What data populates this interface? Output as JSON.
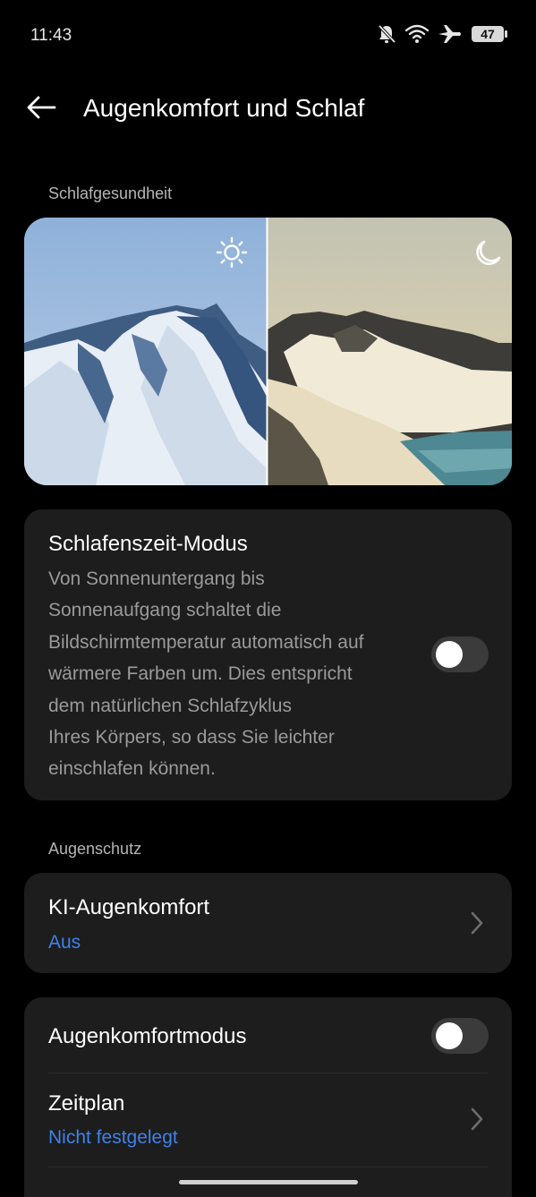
{
  "status_bar": {
    "time": "11:43",
    "battery": "47",
    "icons": [
      "bell-off-icon",
      "wifi-icon",
      "airplane-icon",
      "battery-icon"
    ]
  },
  "header": {
    "title": "Augenkomfort und Schlaf",
    "back_icon": "arrow-left-icon"
  },
  "sections": {
    "sleep_health": "Schlafgesundheit",
    "eye_protection": "Augenschutz"
  },
  "preview": {
    "day_icon": "sun-icon",
    "night_icon": "moon-icon"
  },
  "bedtime_mode": {
    "title": "Schlafenszeit-Modus",
    "description_lines": [
      "Von Sonnenuntergang bis",
      "Sonnenaufgang schaltet die",
      "Bildschirmtemperatur automatisch auf",
      "wärmere Farben um. Dies entspricht",
      "dem natürlichen Schlafzyklus",
      "Ihres Körpers, so dass Sie leichter",
      "einschlafen können."
    ],
    "enabled": false
  },
  "ai_eye_comfort": {
    "title": "KI-Augenkomfort",
    "status": "Aus"
  },
  "eye_comfort_mode": {
    "title": "Augenkomfortmodus",
    "enabled": false
  },
  "schedule": {
    "title": "Zeitplan",
    "status": "Nicht festgelegt"
  },
  "colors": {
    "accent": "#3f82ea",
    "card_bg": "#1d1d1d",
    "toggle_off": "#3b3b3b"
  }
}
